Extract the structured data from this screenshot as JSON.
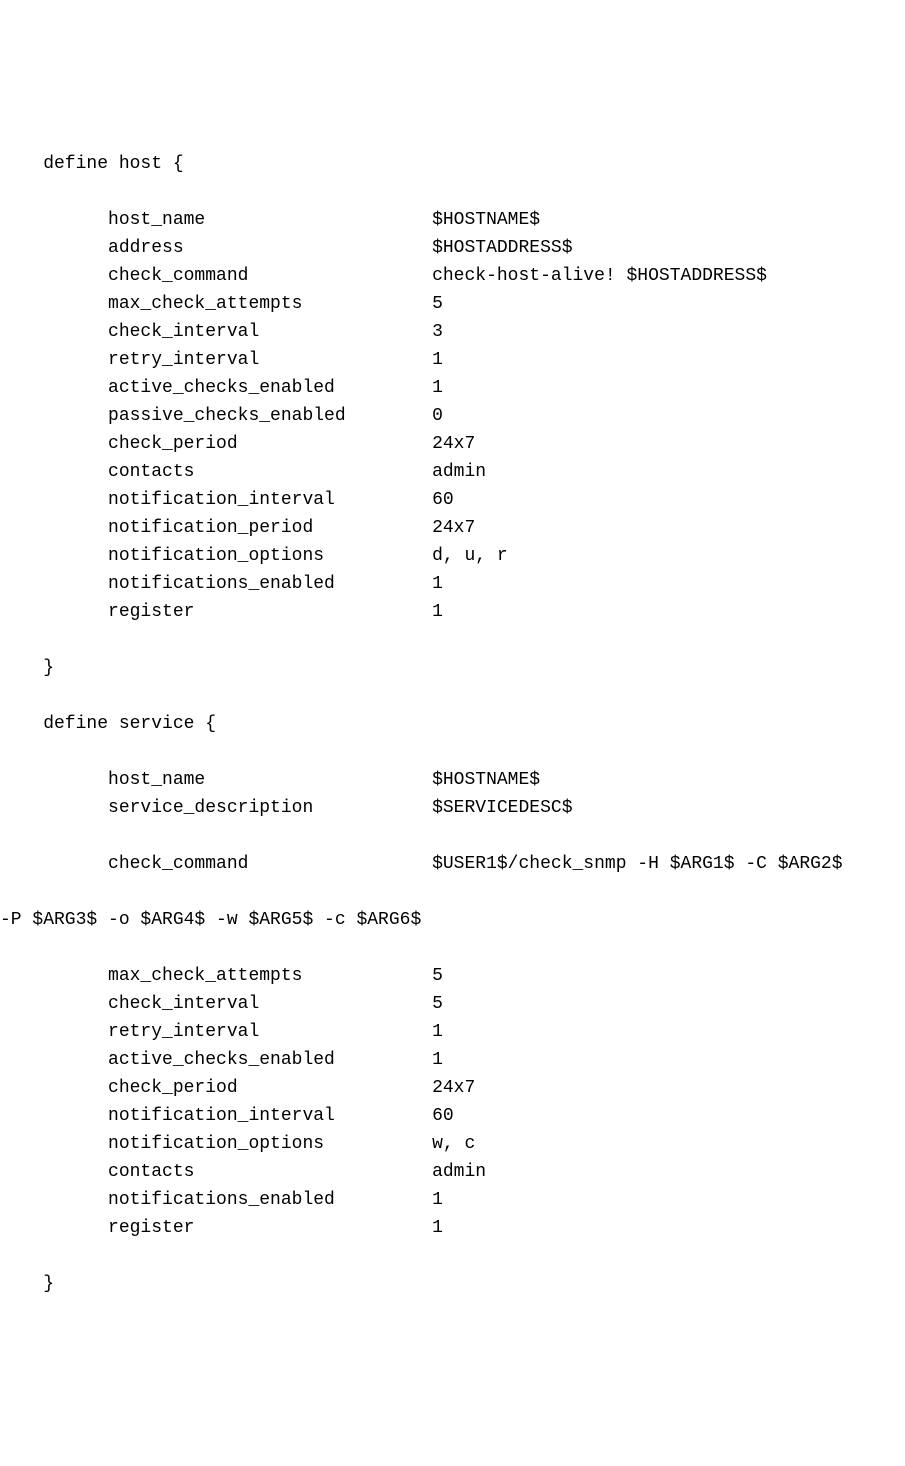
{
  "host": {
    "open": "    define host {",
    "close": "    }",
    "entries": [
      {
        "k": "host_name",
        "v": "$HOSTNAME$"
      },
      {
        "k": "address",
        "v": "$HOSTADDRESS$"
      },
      {
        "k": "check_command",
        "v": "check-host-alive! $HOSTADDRESS$"
      },
      {
        "k": "max_check_attempts",
        "v": "5"
      },
      {
        "k": "check_interval",
        "v": "3"
      },
      {
        "k": "retry_interval",
        "v": "1"
      },
      {
        "k": "active_checks_enabled",
        "v": "1"
      },
      {
        "k": "passive_checks_enabled",
        "v": "0"
      },
      {
        "k": "check_period",
        "v": "24x7"
      },
      {
        "k": "contacts",
        "v": "admin"
      },
      {
        "k": "notification_interval",
        "v": "60"
      },
      {
        "k": "notification_period",
        "v": "24x7"
      },
      {
        "k": "notification_options",
        "v": "d, u, r"
      },
      {
        "k": "notifications_enabled",
        "v": "1"
      },
      {
        "k": "register",
        "v": "1"
      }
    ]
  },
  "service": {
    "open": "    define service {",
    "close": "    }",
    "pre_entries": [
      {
        "k": "host_name",
        "v": "$HOSTNAME$"
      },
      {
        "k": "service_description",
        "v": "$SERVICEDESC$"
      }
    ],
    "check_command": {
      "k": "check_command",
      "v_line1": "$USER1$/check_snmp -H $ARG1$ -C $ARG2$",
      "v_line2": "-P $ARG3$ -o $ARG4$ -w $ARG5$ -c $ARG6$"
    },
    "post_entries": [
      {
        "k": "max_check_attempts",
        "v": "5"
      },
      {
        "k": "check_interval",
        "v": "5"
      },
      {
        "k": "retry_interval",
        "v": "1"
      },
      {
        "k": "active_checks_enabled",
        "v": "1"
      },
      {
        "k": "check_period",
        "v": "24x7"
      },
      {
        "k": "notification_interval",
        "v": "60"
      },
      {
        "k": "notification_options",
        "v": "w, c"
      },
      {
        "k": "contacts",
        "v": "admin"
      },
      {
        "k": "notifications_enabled",
        "v": "1"
      },
      {
        "k": "register",
        "v": "1"
      }
    ]
  }
}
